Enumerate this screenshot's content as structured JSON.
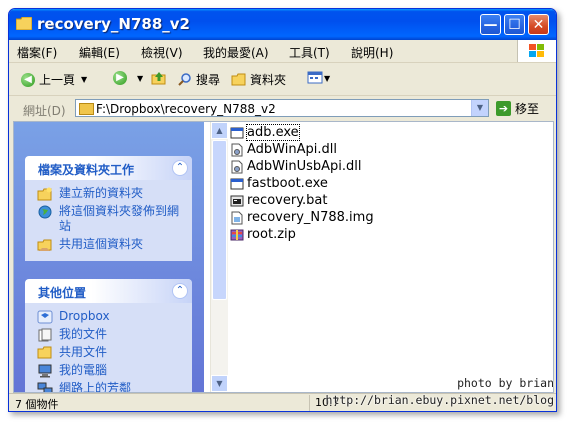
{
  "window": {
    "title": "recovery_N788_v2"
  },
  "title_buttons": {
    "minimize": "—",
    "maximize": "☐",
    "close": "✕"
  },
  "menu": [
    "檔案(F)",
    "編輯(E)",
    "檢視(V)",
    "我的最愛(A)",
    "工具(T)",
    "說明(H)"
  ],
  "toolbar": {
    "back": "上一頁",
    "search": "搜尋",
    "folders": "資料夾"
  },
  "address": {
    "label": "網址(D)",
    "value": "F:\\Dropbox\\recovery_N788_v2",
    "go_label": "移至"
  },
  "tasks_panel": {
    "title": "檔案及資料夾工作",
    "items": [
      "建立新的資料夾",
      "將這個資料夾發佈到網站",
      "共用這個資料夾"
    ]
  },
  "places_panel": {
    "title": "其他位置",
    "items": [
      "Dropbox",
      "我的文件",
      "共用文件",
      "我的電腦",
      "網路上的芳鄰"
    ]
  },
  "files": [
    {
      "name": "adb.exe",
      "icon": "exe-icon"
    },
    {
      "name": "AdbWinApi.dll",
      "icon": "dll-icon"
    },
    {
      "name": "AdbWinUsbApi.dll",
      "icon": "dll-icon"
    },
    {
      "name": "fastboot.exe",
      "icon": "exe-icon"
    },
    {
      "name": "recovery.bat",
      "icon": "bat-icon"
    },
    {
      "name": "recovery_N788.img",
      "icon": "img-icon"
    },
    {
      "name": "root.zip",
      "icon": "zip-icon"
    }
  ],
  "status": {
    "count": "7 個物件",
    "size": "10.7"
  },
  "watermark": {
    "line1": "photo by brian",
    "line2": "http://brian.ebuy.pixnet.net/blog"
  }
}
